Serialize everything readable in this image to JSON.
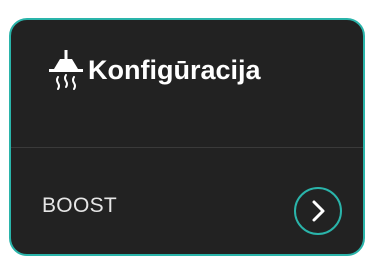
{
  "card": {
    "title": "Konfigūracija",
    "icon": "range-hood-icon",
    "items": [
      {
        "label": "BOOST",
        "icon": "chevron-right-icon"
      }
    ]
  },
  "colors": {
    "background": "#222222",
    "accent": "#2ab4aa",
    "text": "#ffffff"
  }
}
